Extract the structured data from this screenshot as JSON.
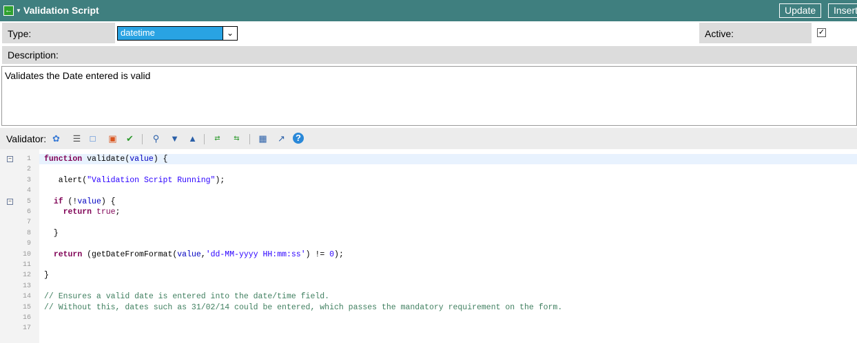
{
  "titlebar": {
    "back_icon": "back-arrow-icon",
    "title": "Validation Script",
    "update_label": "Update",
    "insert_label": "Insert"
  },
  "form": {
    "type_label": "Type:",
    "type_value": "datetime",
    "active_label": "Active:",
    "active_checked": true,
    "description_label": "Description:",
    "description_value": "Validates the Date entered is valid"
  },
  "validator": {
    "label": "Validator:",
    "toolbar_icons": [
      "script-debug-icon",
      "format-code-icon",
      "comment-icon",
      "uncomment-icon",
      "check-syntax-icon",
      "search-icon",
      "chevron-down-icon",
      "chevron-up-icon",
      "replace-icon",
      "replace-all-icon",
      "save-icon",
      "fullscreen-icon",
      "help-icon"
    ]
  },
  "code": {
    "lines": [
      {
        "n": "1",
        "fold": true,
        "text": "function validate(value) {"
      },
      {
        "n": "2",
        "text": ""
      },
      {
        "n": "3",
        "text": "   alert(\"Validation Script Running\");"
      },
      {
        "n": "4",
        "text": ""
      },
      {
        "n": "5",
        "fold": true,
        "text": "  if (!value) {"
      },
      {
        "n": "6",
        "text": "    return true;"
      },
      {
        "n": "7",
        "text": ""
      },
      {
        "n": "8",
        "text": "  }"
      },
      {
        "n": "9",
        "text": ""
      },
      {
        "n": "10",
        "text": "  return (getDateFromFormat(value,'dd-MM-yyyy HH:mm:ss') != 0);"
      },
      {
        "n": "11",
        "text": ""
      },
      {
        "n": "12",
        "text": "}"
      },
      {
        "n": "13",
        "text": ""
      },
      {
        "n": "14",
        "text": "// Ensures a valid date is entered into the date/time field."
      },
      {
        "n": "15",
        "text": "// Without this, dates such as 31/02/14 could be entered, which passes the mandatory requirement on the form."
      },
      {
        "n": "16",
        "text": ""
      },
      {
        "n": "17",
        "text": ""
      }
    ]
  }
}
